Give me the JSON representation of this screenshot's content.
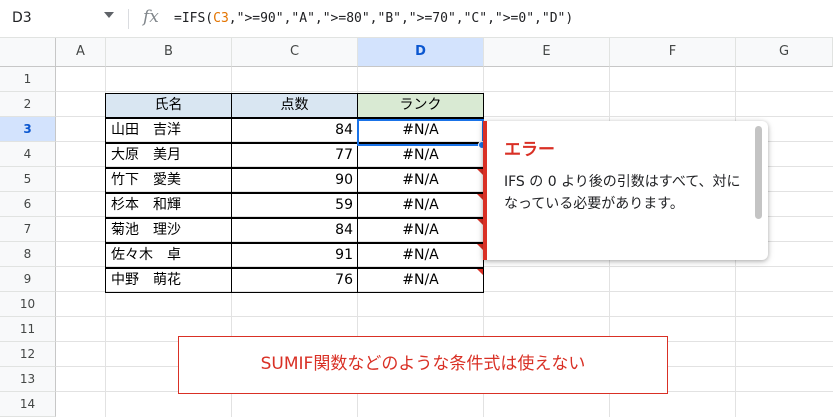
{
  "formula_bar": {
    "cell_ref": "D3",
    "fx_icon": "fx",
    "formula_prefix": "=IFS(",
    "formula_ref": "C3",
    "formula_suffix": ",\">=90\",\"A\",\">=80\",\"B\",\">=70\",\"C\",\">=0\",\"D\")"
  },
  "columns": [
    "A",
    "B",
    "C",
    "D",
    "E",
    "F",
    "G"
  ],
  "rows": [
    "1",
    "2",
    "3",
    "4",
    "5",
    "6",
    "7",
    "8",
    "9",
    "10",
    "11",
    "12",
    "13",
    "14"
  ],
  "selected_column": "D",
  "selected_row": "3",
  "table": {
    "headers": [
      "氏名",
      "点数",
      "ランク"
    ],
    "rows": [
      {
        "name": "山田　吉洋",
        "score": "84",
        "rank": "#N/A"
      },
      {
        "name": "大原　美月",
        "score": "77",
        "rank": "#N/A"
      },
      {
        "name": "竹下　愛美",
        "score": "90",
        "rank": "#N/A"
      },
      {
        "name": "杉本　和輝",
        "score": "59",
        "rank": "#N/A"
      },
      {
        "name": "菊池　理沙",
        "score": "84",
        "rank": "#N/A"
      },
      {
        "name": "佐々木　卓",
        "score": "91",
        "rank": "#N/A"
      },
      {
        "name": "中野　萌花",
        "score": "76",
        "rank": "#N/A"
      }
    ]
  },
  "error_popup": {
    "title": "エラー",
    "message": "IFS の 0 より後の引数はすべて、対になっている必要があります。"
  },
  "annotation": "SUMIF関数などのような条件式は使えない",
  "colors": {
    "error": "#d93025",
    "selection": "#1a73e8",
    "header_blue": "#d9e6f2",
    "header_green": "#d9ead3"
  }
}
